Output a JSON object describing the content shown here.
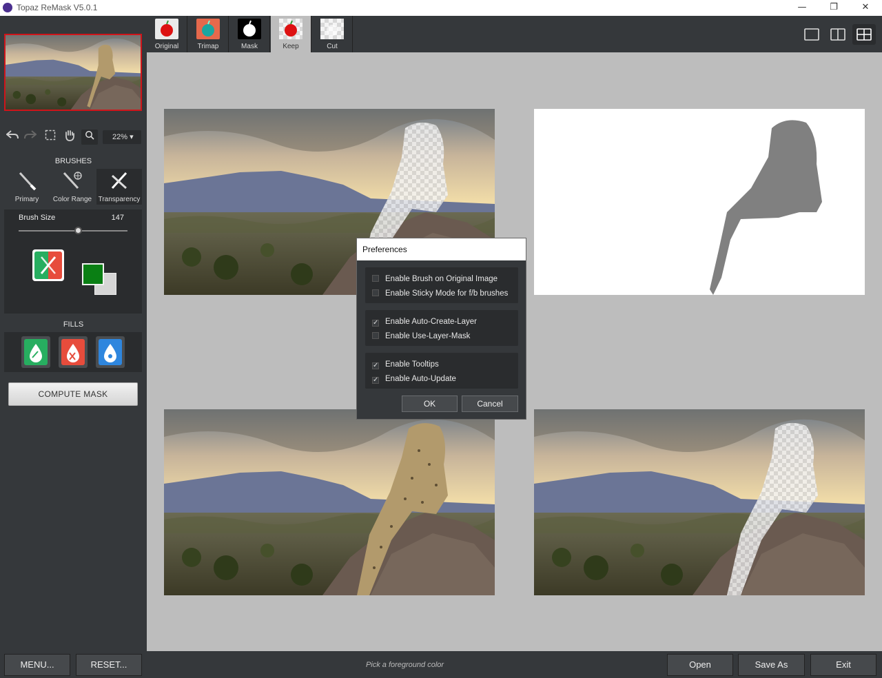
{
  "window": {
    "title": "Topaz ReMask V5.0.1",
    "minimize": "—",
    "restore": "❐",
    "close": "✕"
  },
  "toolbar": {
    "zoom": "22% ▾"
  },
  "brushes": {
    "title": "BRUSHES",
    "items": [
      {
        "label": "Primary",
        "active": false
      },
      {
        "label": "Color Range",
        "active": false
      },
      {
        "label": "Transparency",
        "active": true
      }
    ],
    "size_label": "Brush Size",
    "size_value": "147",
    "size_fraction": 0.55,
    "foreground_color": "#0a7f14",
    "background_color": "#d6d6d6"
  },
  "fills": {
    "title": "FILLS",
    "colors": [
      "#27ae60",
      "#e74c3c",
      "#2e86de"
    ]
  },
  "compute_label": "COMPUTE MASK",
  "tabs": [
    {
      "label": "Original",
      "icon": "apple-red-icon",
      "active": false
    },
    {
      "label": "Trimap",
      "icon": "apple-trimap-icon",
      "active": false
    },
    {
      "label": "Mask",
      "icon": "apple-mask-icon",
      "active": false
    },
    {
      "label": "Keep",
      "icon": "apple-keep-icon",
      "active": true
    },
    {
      "label": "Cut",
      "icon": "apple-cut-icon",
      "active": false
    }
  ],
  "preferences": {
    "title": "Preferences",
    "options": [
      {
        "label": "Enable Brush on Original Image",
        "checked": false
      },
      {
        "label": "Enable Sticky Mode for f/b brushes",
        "checked": false
      },
      {
        "label": "Enable Auto-Create-Layer",
        "checked": true
      },
      {
        "label": "Enable Use-Layer-Mask",
        "checked": false
      },
      {
        "label": "Enable Tooltips",
        "checked": true
      },
      {
        "label": "Enable Auto-Update",
        "checked": true
      }
    ],
    "ok": "OK",
    "cancel": "Cancel"
  },
  "bottom": {
    "menu": "MENU...",
    "reset": "RESET...",
    "status": "Pick a foreground color",
    "open": "Open",
    "save_as": "Save As",
    "exit": "Exit"
  },
  "colors": {
    "panel": "#35383b",
    "panel_dark": "#2a2c2e",
    "canvas": "#bdbdbd",
    "thumb_border": "#d0141a"
  }
}
